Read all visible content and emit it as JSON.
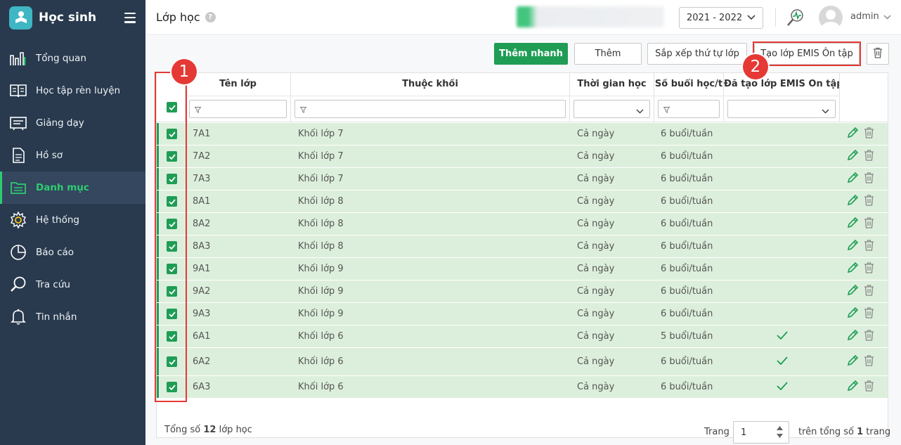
{
  "app": {
    "name": "Học sinh"
  },
  "sidebar": {
    "items": [
      {
        "label": "Tổng quan",
        "icon": "bar-chart-icon",
        "active": false
      },
      {
        "label": "Học tập rèn luyện",
        "icon": "book-icon",
        "active": false
      },
      {
        "label": "Giảng dạy",
        "icon": "blackboard-icon",
        "active": false
      },
      {
        "label": "Hồ sơ",
        "icon": "document-icon",
        "active": false
      },
      {
        "label": "Danh mục",
        "icon": "folder-icon",
        "active": true
      },
      {
        "label": "Hệ thống",
        "icon": "gear-icon",
        "active": false
      },
      {
        "label": "Báo cáo",
        "icon": "pie-chart-icon",
        "active": false
      },
      {
        "label": "Tra cứu",
        "icon": "search-icon",
        "active": false
      },
      {
        "label": "Tin nhắn",
        "icon": "bell-icon",
        "active": false
      }
    ]
  },
  "header": {
    "title": "Lớp học",
    "help": "?",
    "year": "2021 - 2022",
    "user": "admin"
  },
  "toolbar": {
    "quick_add": "Thêm nhanh",
    "add": "Thêm",
    "sort": "Sắp xếp thứ tự lớp",
    "create_emis": "Tạo lớp EMIS Ôn tập"
  },
  "annotations": {
    "marker1": "1",
    "marker2": "2"
  },
  "table": {
    "columns": [
      "Tên lớp",
      "Thuộc khối",
      "Thời gian học",
      "Số buổi học/t",
      "Đã tạo lớp EMIS Ôn tập"
    ],
    "rows": [
      {
        "name": "7A1",
        "grade": "Khối lớp 7",
        "time": "Cả ngày",
        "sessions": "6 buổi/tuần",
        "created": false
      },
      {
        "name": "7A2",
        "grade": "Khối lớp 7",
        "time": "Cả ngày",
        "sessions": "6 buổi/tuần",
        "created": false
      },
      {
        "name": "7A3",
        "grade": "Khối lớp 7",
        "time": "Cả ngày",
        "sessions": "6 buổi/tuần",
        "created": false
      },
      {
        "name": "8A1",
        "grade": "Khối lớp 8",
        "time": "Cả ngày",
        "sessions": "6 buổi/tuần",
        "created": false
      },
      {
        "name": "8A2",
        "grade": "Khối lớp 8",
        "time": "Cả ngày",
        "sessions": "6 buổi/tuần",
        "created": false
      },
      {
        "name": "8A3",
        "grade": "Khối lớp 8",
        "time": "Cả ngày",
        "sessions": "6 buổi/tuần",
        "created": false
      },
      {
        "name": "9A1",
        "grade": "Khối lớp 9",
        "time": "Cả ngày",
        "sessions": "6 buổi/tuần",
        "created": false
      },
      {
        "name": "9A2",
        "grade": "Khối lớp 9",
        "time": "Cả ngày",
        "sessions": "6 buổi/tuần",
        "created": false
      },
      {
        "name": "9A3",
        "grade": "Khối lớp 9",
        "time": "Cả ngày",
        "sessions": "6 buổi/tuần",
        "created": false
      },
      {
        "name": "6A1",
        "grade": "Khối lớp 6",
        "time": "Cả ngày",
        "sessions": "5 buổi/tuần",
        "created": true
      },
      {
        "name": "6A2",
        "grade": "Khối lớp 6",
        "time": "Cả ngày",
        "sessions": "6 buổi/tuần",
        "created": true
      },
      {
        "name": "6A3",
        "grade": "Khối lớp 6",
        "time": "Cả ngày",
        "sessions": "6 buổi/tuần",
        "created": true
      }
    ]
  },
  "footer": {
    "total_prefix": "Tổng số ",
    "total_count": "12",
    "total_suffix": " lớp học",
    "page_label": "Trang",
    "page_value": "1",
    "of_prefix": "trên tổng số ",
    "of_count": "1",
    "of_suffix": " trang"
  },
  "colors": {
    "sidebar": "#293a4e",
    "accent": "#1f9d55",
    "row_selected": "#dcefdc",
    "highlight": "#e53935"
  }
}
